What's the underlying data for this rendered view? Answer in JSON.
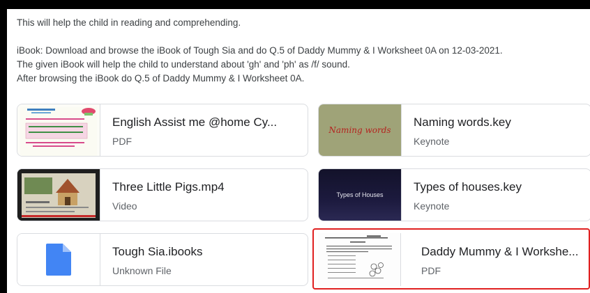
{
  "description": {
    "line1": "This will help the child in reading and comprehending.",
    "line2": "iBook: Download and browse the iBook of Tough Sia and do Q.5 of Daddy Mummy & I Worksheet 0A on 12-03-2021.",
    "line3": "The given iBook will help the child to understand about 'gh' and 'ph' as /f/ sound.",
    "line4": "After browsing the iBook do Q.5 of Daddy Mummy & I Worksheet 0A."
  },
  "attachments": [
    {
      "title": "English Assist me @home Cy...",
      "type": "PDF",
      "thumb": "pdf-page-thumbnail"
    },
    {
      "title": "Naming words.key",
      "type": "Keynote",
      "thumb_text": "Naming words"
    },
    {
      "title": "Three Little Pigs.mp4",
      "type": "Video",
      "thumb": "video-thumbnail"
    },
    {
      "title": "Types of houses.key",
      "type": "Keynote",
      "thumb_text": "Types of Houses"
    },
    {
      "title": "Tough Sia.ibooks",
      "type": "Unknown File",
      "thumb": "file-icon"
    },
    {
      "title": "Daddy Mummy & I Workshe...",
      "type": "PDF",
      "thumb": "worksheet-thumbnail",
      "selected": true
    }
  ],
  "colors": {
    "file_icon": "#4285f4",
    "selection_border": "#e02020"
  }
}
